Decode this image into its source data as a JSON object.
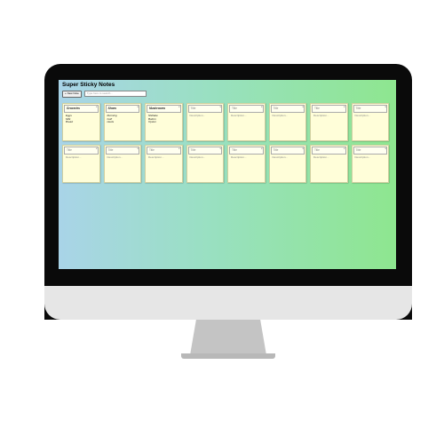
{
  "app": {
    "title": "Super Sticky Notes",
    "new_note_label": "+ New Note",
    "search_placeholder": "Type here to search..."
  },
  "notes": [
    {
      "title": "Groceries",
      "lines": [
        "Eggs",
        "Milk",
        "Bread"
      ]
    },
    {
      "title": "Shoes",
      "lines": [
        "Running",
        "Golf",
        "Heels"
      ]
    },
    {
      "title": "Mushrooms",
      "lines": [
        "Shiitake",
        "Button",
        "Oyster"
      ]
    },
    {
      "title": "Title",
      "lines": [
        "Description..."
      ]
    },
    {
      "title": "Title",
      "lines": [
        "Description..."
      ]
    },
    {
      "title": "Title",
      "lines": [
        "Description..."
      ]
    },
    {
      "title": "Title",
      "lines": [
        "Description..."
      ]
    },
    {
      "title": "Title",
      "lines": [
        "Description..."
      ]
    },
    {
      "title": "Title",
      "lines": [
        "Description..."
      ]
    },
    {
      "title": "Title",
      "lines": [
        "Description..."
      ]
    },
    {
      "title": "Title",
      "lines": [
        "Description..."
      ]
    },
    {
      "title": "Title",
      "lines": [
        "Description..."
      ]
    },
    {
      "title": "Title",
      "lines": [
        "Description..."
      ]
    },
    {
      "title": "Title",
      "lines": [
        "Description..."
      ]
    },
    {
      "title": "Title",
      "lines": [
        "Description..."
      ]
    },
    {
      "title": "Title",
      "lines": [
        "Description..."
      ]
    }
  ],
  "close_glyph": "x",
  "colors": {
    "note_bg": "#fffed9",
    "screen_left": "#a9d4e8",
    "screen_right": "#8ee68f"
  }
}
